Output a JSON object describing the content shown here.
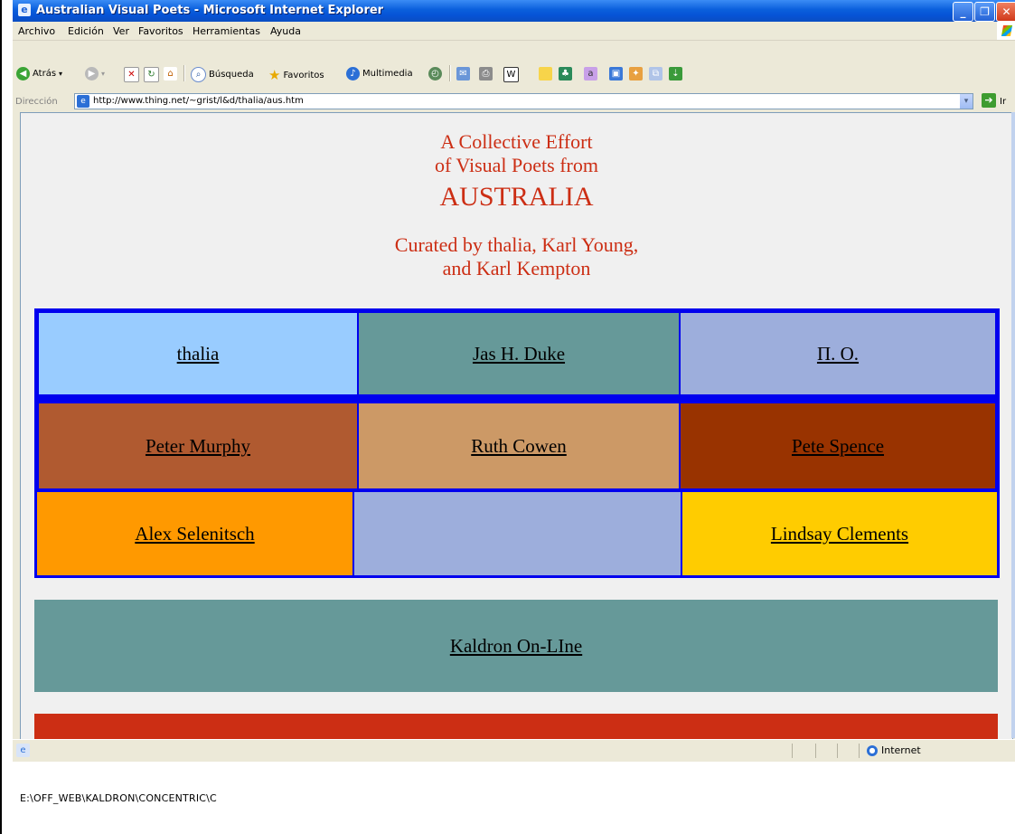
{
  "window": {
    "title": "Australian Visual Poets - Microsoft Internet Explorer",
    "titlebar_color": "#0a5fdc"
  },
  "menu": [
    "Archivo",
    "Edición",
    "Ver",
    "Favoritos",
    "Herramientas",
    "Ayuda"
  ],
  "toolbar": {
    "back_label": "Atrás",
    "search_label": "Búsqueda",
    "favorites_label": "Favoritos",
    "media_label": "Multimedia"
  },
  "address": {
    "label": "Dirección",
    "url": "http://www.thing.net/~grist/l&d/thalia/aus.htm",
    "go_label": "Ir"
  },
  "page": {
    "heading_line1": "A Collective Effort",
    "heading_line2": "of Visual Poets from",
    "heading_country": "AUSTRALIA",
    "curators_line1": "Curated by thalia, Karl Young,",
    "curators_line2": "and Karl Kempton",
    "heading_color": "#cc2e14",
    "rows": [
      [
        {
          "name": "thalia",
          "bg": "#99ccff"
        },
        {
          "name": "Jas H. Duke",
          "bg": "#669999"
        },
        {
          "name": "Π. O.",
          "bg": "#9daedc"
        }
      ],
      [
        {
          "name": "Peter Murphy",
          "bg": "#b05a30"
        },
        {
          "name": "Ruth Cowen",
          "bg": "#cc9966"
        },
        {
          "name": "Pete Spence",
          "bg": "#993300"
        }
      ],
      [
        {
          "name": "Alex Selenitsch",
          "bg": "#ff9900"
        },
        {
          "name": "",
          "bg": "#9daedc"
        },
        {
          "name": "Lindsay Clements",
          "bg": "#ffcc00"
        }
      ]
    ],
    "kaldron_link": "Kaldron On-LIne",
    "kaldron_bg": "#669999",
    "next_band_bg": "#cc2e14"
  },
  "status": {
    "zone": "Internet"
  },
  "footer": {
    "path": "E:\\OFF_WEB\\KALDRON\\CONCENTRIC\\C"
  }
}
